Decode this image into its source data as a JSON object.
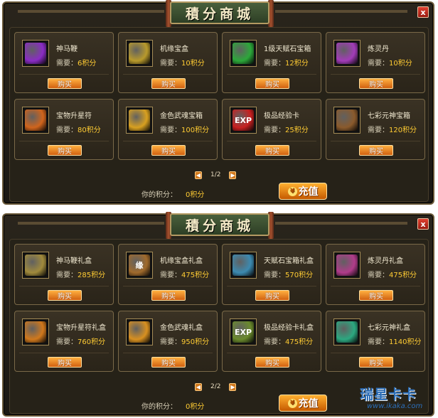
{
  "panels": [
    {
      "title": "積分商城",
      "close_label": "x",
      "items": [
        {
          "name": "神马鞭",
          "price_label": "需要：",
          "price": "6积分",
          "buy_label": "购买",
          "icon": "purple-bowl-icon",
          "icon_color": "#8a2cc4"
        },
        {
          "name": "机缘宝盒",
          "price_label": "需要：",
          "price": "10积分",
          "buy_label": "购买",
          "icon": "gold-box-icon",
          "icon_color": "#b89a2c"
        },
        {
          "name": "1级天赋石宝箱",
          "price_label": "需要：",
          "price": "12积分",
          "buy_label": "购买",
          "icon": "green-chest-icon",
          "icon_color": "#2ca83a"
        },
        {
          "name": "炼灵丹",
          "price_label": "需要：",
          "price": "10积分",
          "buy_label": "购买",
          "icon": "pill-orb-icon",
          "icon_color": "#a23cb8"
        },
        {
          "name": "宝物升星符",
          "price_label": "需要：",
          "price": "80积分",
          "buy_label": "购买",
          "icon": "scroll-icon",
          "icon_color": "#d0641c"
        },
        {
          "name": "金色武魂宝箱",
          "price_label": "需要：",
          "price": "100积分",
          "buy_label": "购买",
          "icon": "golden-chest-icon",
          "icon_color": "#d8a020"
        },
        {
          "name": "极品经验卡",
          "price_label": "需要：",
          "price": "25积分",
          "buy_label": "购买",
          "icon": "exp-card-icon",
          "icon_color": "#c82020",
          "icon_text": "EXP"
        },
        {
          "name": "七彩元神宝箱",
          "price_label": "需要：",
          "price": "120积分",
          "buy_label": "购买",
          "icon": "wooden-chest-icon",
          "icon_color": "#8a5a2c"
        }
      ],
      "page": "1/2",
      "prev_label": "◀",
      "next_label": "▶",
      "points_label": "你的积分：",
      "points_value": "0积分",
      "recharge_label": "充值",
      "recharge_coin": "¥"
    },
    {
      "title": "積分商城",
      "close_label": "x",
      "items": [
        {
          "name": "神马鞭礼盒",
          "price_label": "需要：",
          "price": "285积分",
          "buy_label": "购买",
          "icon": "gift-box-bowl-icon",
          "icon_color": "#a08a3c"
        },
        {
          "name": "机缘宝盒礼盒",
          "price_label": "需要：",
          "price": "475积分",
          "buy_label": "购买",
          "icon": "gift-box-seal-icon",
          "icon_color": "#a06a2c",
          "icon_text": "缘"
        },
        {
          "name": "天赋石宝箱礼盒",
          "price_label": "需要：",
          "price": "570积分",
          "buy_label": "购买",
          "icon": "gift-box-gems-icon",
          "icon_color": "#3c8ab0"
        },
        {
          "name": "炼灵丹礼盒",
          "price_label": "需要：",
          "price": "475积分",
          "buy_label": "购买",
          "icon": "gift-box-pill-icon",
          "icon_color": "#b03c8a"
        },
        {
          "name": "宝物升星符礼盒",
          "price_label": "需要：",
          "price": "760积分",
          "buy_label": "购买",
          "icon": "gift-box-scroll-icon",
          "icon_color": "#d0781c"
        },
        {
          "name": "金色武魂礼盒",
          "price_label": "需要：",
          "price": "950积分",
          "buy_label": "购买",
          "icon": "gift-box-flame-icon",
          "icon_color": "#d89020"
        },
        {
          "name": "极品经验卡礼盒",
          "price_label": "需要：",
          "price": "475积分",
          "buy_label": "购买",
          "icon": "gift-box-exp-icon",
          "icon_color": "#6a8a2c",
          "icon_text": "EXP"
        },
        {
          "name": "七彩元神礼盒",
          "price_label": "需要：",
          "price": "1140积分",
          "buy_label": "购买",
          "icon": "gift-box-orb-icon",
          "icon_color": "#2ca880"
        }
      ],
      "page": "2/2",
      "prev_label": "◀",
      "next_label": "▶",
      "points_label": "你的积分：",
      "points_value": "0积分",
      "recharge_label": "充值",
      "recharge_coin": "¥"
    }
  ],
  "watermark": {
    "title": "瑞星卡卡",
    "url": "www.ikaka.com"
  }
}
